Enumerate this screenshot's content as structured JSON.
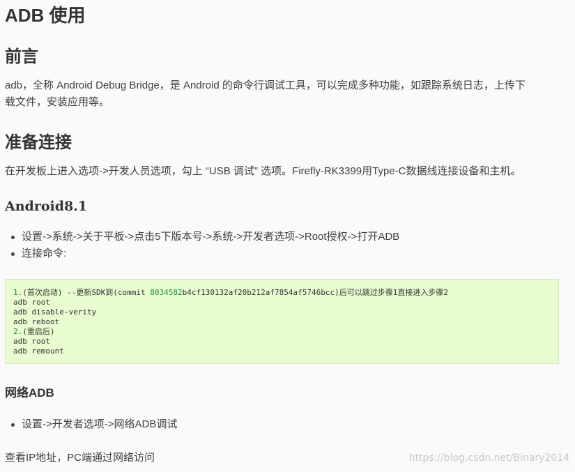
{
  "title": "ADB 使用",
  "sections": {
    "preface": {
      "heading": "前言",
      "paragraph_line1": "adb，全称 Android Debug Bridge，是 Android 的命令行调试工具，可以完成多种功能，如跟踪系统日志，上传下",
      "paragraph_line2": "载文件，安装应用等。"
    },
    "prepare": {
      "heading": "准备连接",
      "paragraph": "在开发板上进入选项->开发人员选项，勾上 “USB 调试” 选项。Firefly-RK3399用Type-C数据线连接设备和主机。"
    },
    "android81": {
      "heading": "Android8.1",
      "bullets": [
        "设置->系统->关于平板->点击5下版本号->系统->开发者选项->Root授权->打开ADB",
        "连接命令:"
      ],
      "code": {
        "line1_prefix": "1.",
        "line1_a": "(首次启动) --更新SDK到(commit ",
        "line1_hash": "8034582",
        "line1_b": "b4cf130132af20b212af7854af5746bcc)后可以跳过步骤1直接进入步骤2",
        "lines_mid": [
          "adb root",
          "adb disable-verity",
          "adb reboot"
        ],
        "line5_prefix": "2.",
        "line5_a": "(重启后)",
        "lines_end": [
          "adb root",
          "adb remount"
        ]
      }
    },
    "network": {
      "heading": "网络ADB",
      "bullets": [
        "设置->开发者选项->网络ADB调试"
      ],
      "paragraph": "查看IP地址，PC端通过网络访问"
    }
  },
  "watermark": "https://blog.csdn.net/Binary2014"
}
